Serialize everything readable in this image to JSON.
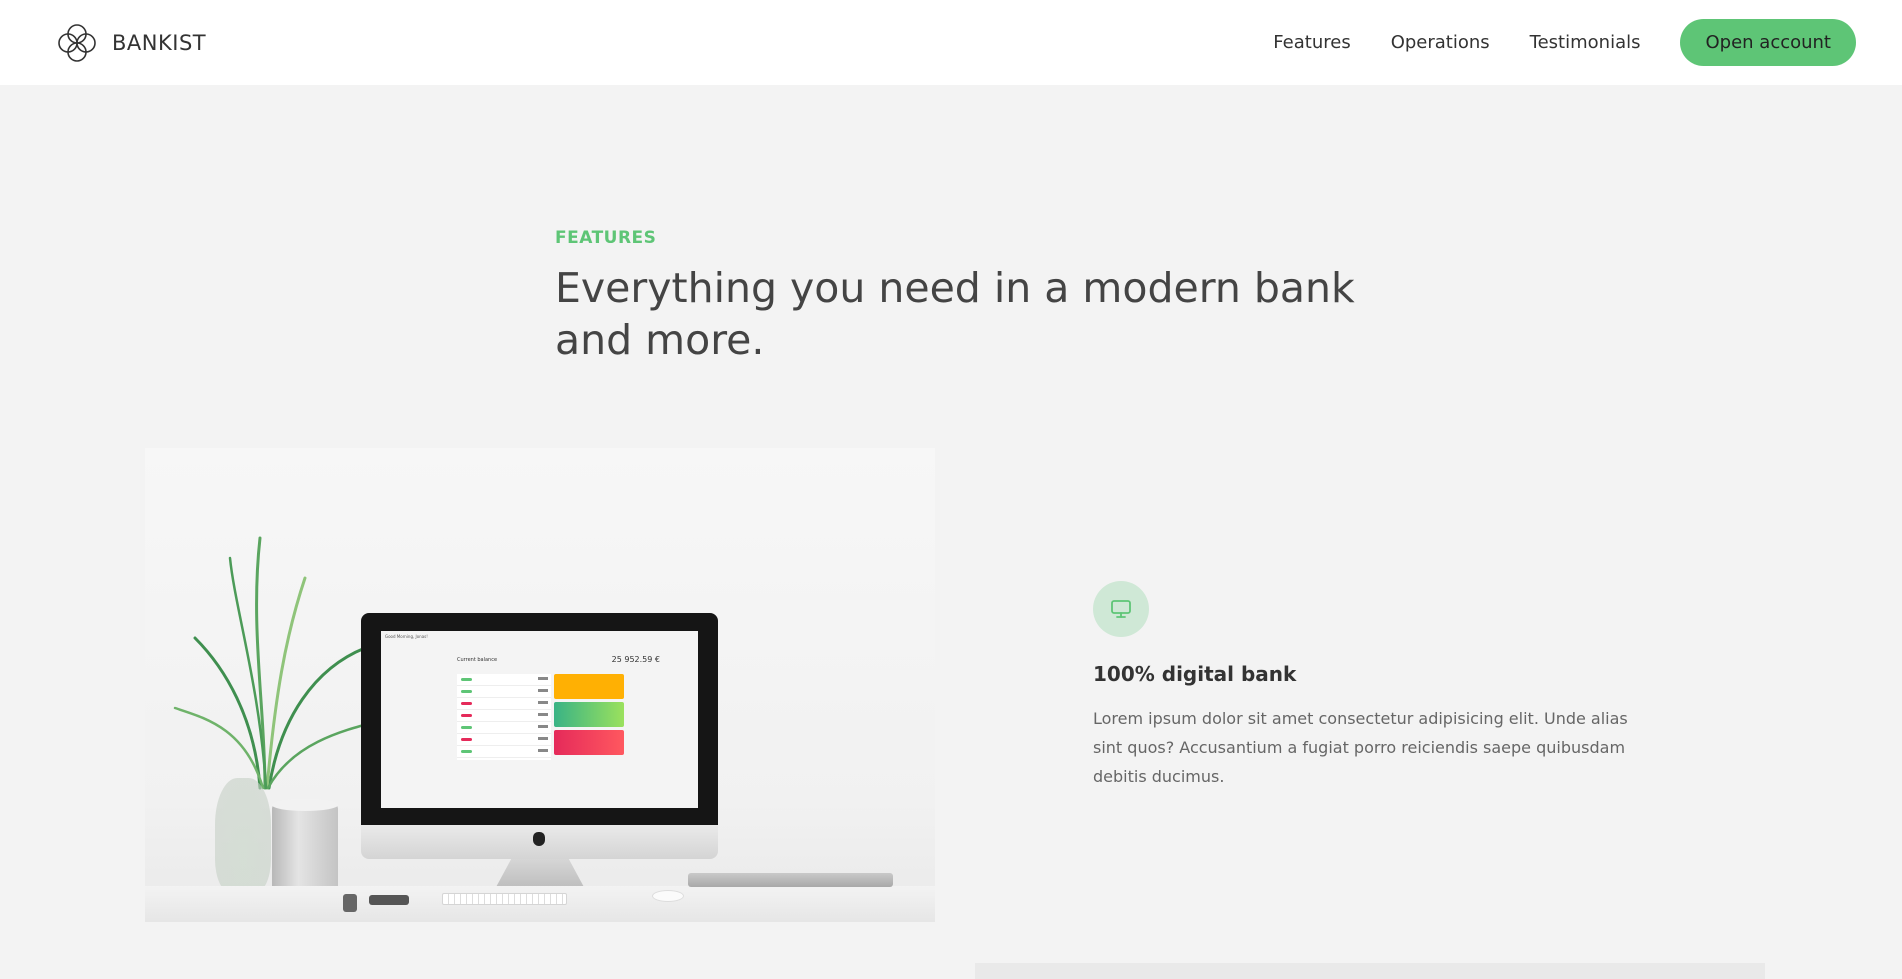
{
  "nav": {
    "brand": "BANKIST",
    "links": [
      "Features",
      "Operations",
      "Testimonials"
    ],
    "cta": "Open account"
  },
  "section": {
    "eyebrow": "FEATURES",
    "title": "Everything you need in a modern bank and more."
  },
  "feature": {
    "icon": "monitor-icon",
    "title": "100% digital bank",
    "description": "Lorem ipsum dolor sit amet consectetur adipisicing elit. Unde alias sint quos? Accusantium a fugiat porro reiciendis saepe quibusdam debitis ducimus."
  },
  "screen": {
    "greeting": "Good Morning, Jonas!",
    "balance_label": "Current balance",
    "balance": "25 952.59 €"
  },
  "colors": {
    "accent": "#5ec576",
    "icon_bg": "#cfe8d6",
    "page_bg": "#f3f3f3",
    "nav_bg": "#ffffff"
  }
}
